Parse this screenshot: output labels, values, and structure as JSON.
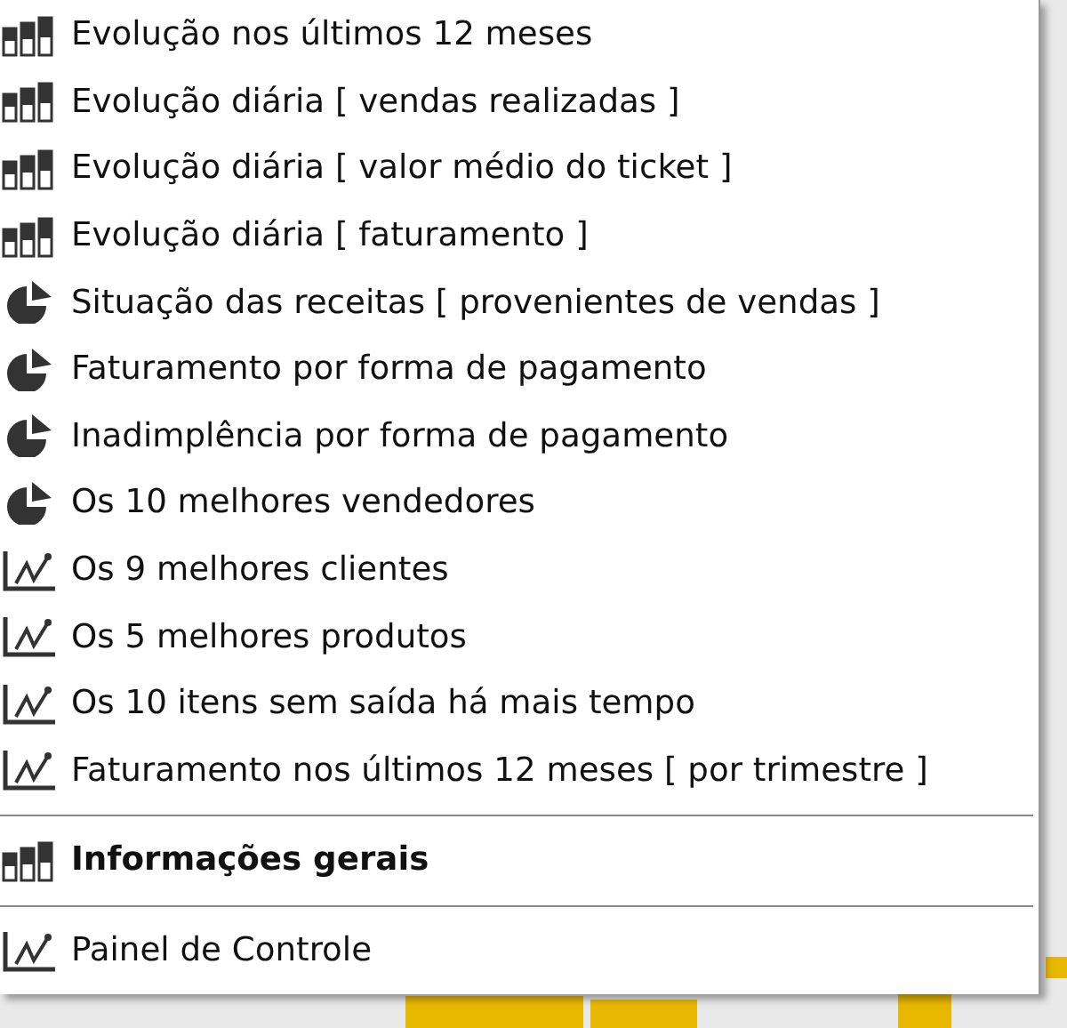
{
  "menu": {
    "items": [
      {
        "kind": "bar",
        "label": "Evolução nos últimos 12 meses",
        "bold": false
      },
      {
        "kind": "bar",
        "label": "Evolução diária [ vendas realizadas ]",
        "bold": false
      },
      {
        "kind": "bar",
        "label": "Evolução diária [ valor médio do ticket ]",
        "bold": false
      },
      {
        "kind": "bar",
        "label": "Evolução diária [ faturamento ]",
        "bold": false
      },
      {
        "kind": "pie",
        "label": "Situação das receitas [ provenientes de vendas ]",
        "bold": false
      },
      {
        "kind": "pie",
        "label": "Faturamento por forma de pagamento",
        "bold": false
      },
      {
        "kind": "pie",
        "label": "Inadimplência por forma de pagamento",
        "bold": false
      },
      {
        "kind": "pie",
        "label": "Os 10 melhores vendedores",
        "bold": false
      },
      {
        "kind": "line",
        "label": "Os 9 melhores clientes",
        "bold": false
      },
      {
        "kind": "line",
        "label": "Os 5 melhores produtos",
        "bold": false
      },
      {
        "kind": "line",
        "label": "Os 10 itens sem saída há mais tempo",
        "bold": false
      },
      {
        "kind": "line",
        "label": "Faturamento nos últimos 12 meses [ por trimestre ]",
        "bold": false
      },
      {
        "kind": "separator"
      },
      {
        "kind": "bar",
        "label": "Informações gerais",
        "bold": true
      },
      {
        "kind": "separator"
      },
      {
        "kind": "line",
        "label": "Painel de Controle",
        "bold": false
      }
    ]
  }
}
